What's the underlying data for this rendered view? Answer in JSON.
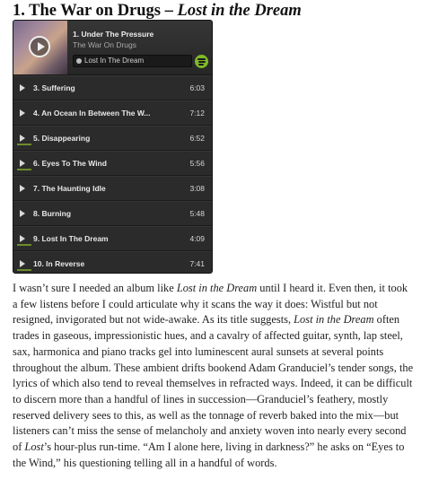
{
  "heading": {
    "prefix": "1. The War on Drugs – ",
    "album": "Lost in the Dream"
  },
  "player": {
    "now_playing": {
      "title": "1. Under The Pressure",
      "artist": "The War On Drugs",
      "album": "Lost In The Dream"
    },
    "brand_color": "#7fb928",
    "tracks": [
      {
        "name": "3. Suffering",
        "duration": "6:03",
        "bar": false
      },
      {
        "name": "4. An Ocean In Between The W...",
        "duration": "7:12",
        "bar": false
      },
      {
        "name": "5. Disappearing",
        "duration": "6:52",
        "bar": true
      },
      {
        "name": "6. Eyes To The Wind",
        "duration": "5:56",
        "bar": true
      },
      {
        "name": "7. The Haunting Idle",
        "duration": "3:08",
        "bar": false
      },
      {
        "name": "8. Burning",
        "duration": "5:48",
        "bar": false
      },
      {
        "name": "9. Lost In The Dream",
        "duration": "4:09",
        "bar": true
      },
      {
        "name": "10. In Reverse",
        "duration": "7:41",
        "bar": true
      }
    ]
  },
  "article": {
    "s1": "I wasn’t sure I needed an album like ",
    "i1": "Lost in the Dream",
    "s2": " until I heard it. Even then, it took a few listens before I could articulate why it scans the way it does: Wistful but not resigned, invigorated but not wide-awake. As its title suggests, ",
    "i2": "Lost in the Dream",
    "s3": " often trades in gaseous, impressionistic hues, and a cavalry of affected guitar, synth, lap steel, sax, harmonica and piano tracks gel into luminescent aural sunsets at several points throughout the album. These ambient drifts bookend Adam Granduciel’s tender songs, the lyrics of which also tend to reveal themselves in refracted ways. Indeed, it can be difficult to discern more than a handful of lines in succession—Granduciel’s feathery, mostly reserved delivery sees to this, as well as the tonnage of reverb baked into the mix—but listeners can’t miss the sense of melancholy and anxiety woven into nearly every second of ",
    "i3": "Lost",
    "s4": "’s hour-plus run-time. “Am I alone here, living in darkness?” he asks on “Eyes to the Wind,” his questioning telling all in a handful of words."
  }
}
